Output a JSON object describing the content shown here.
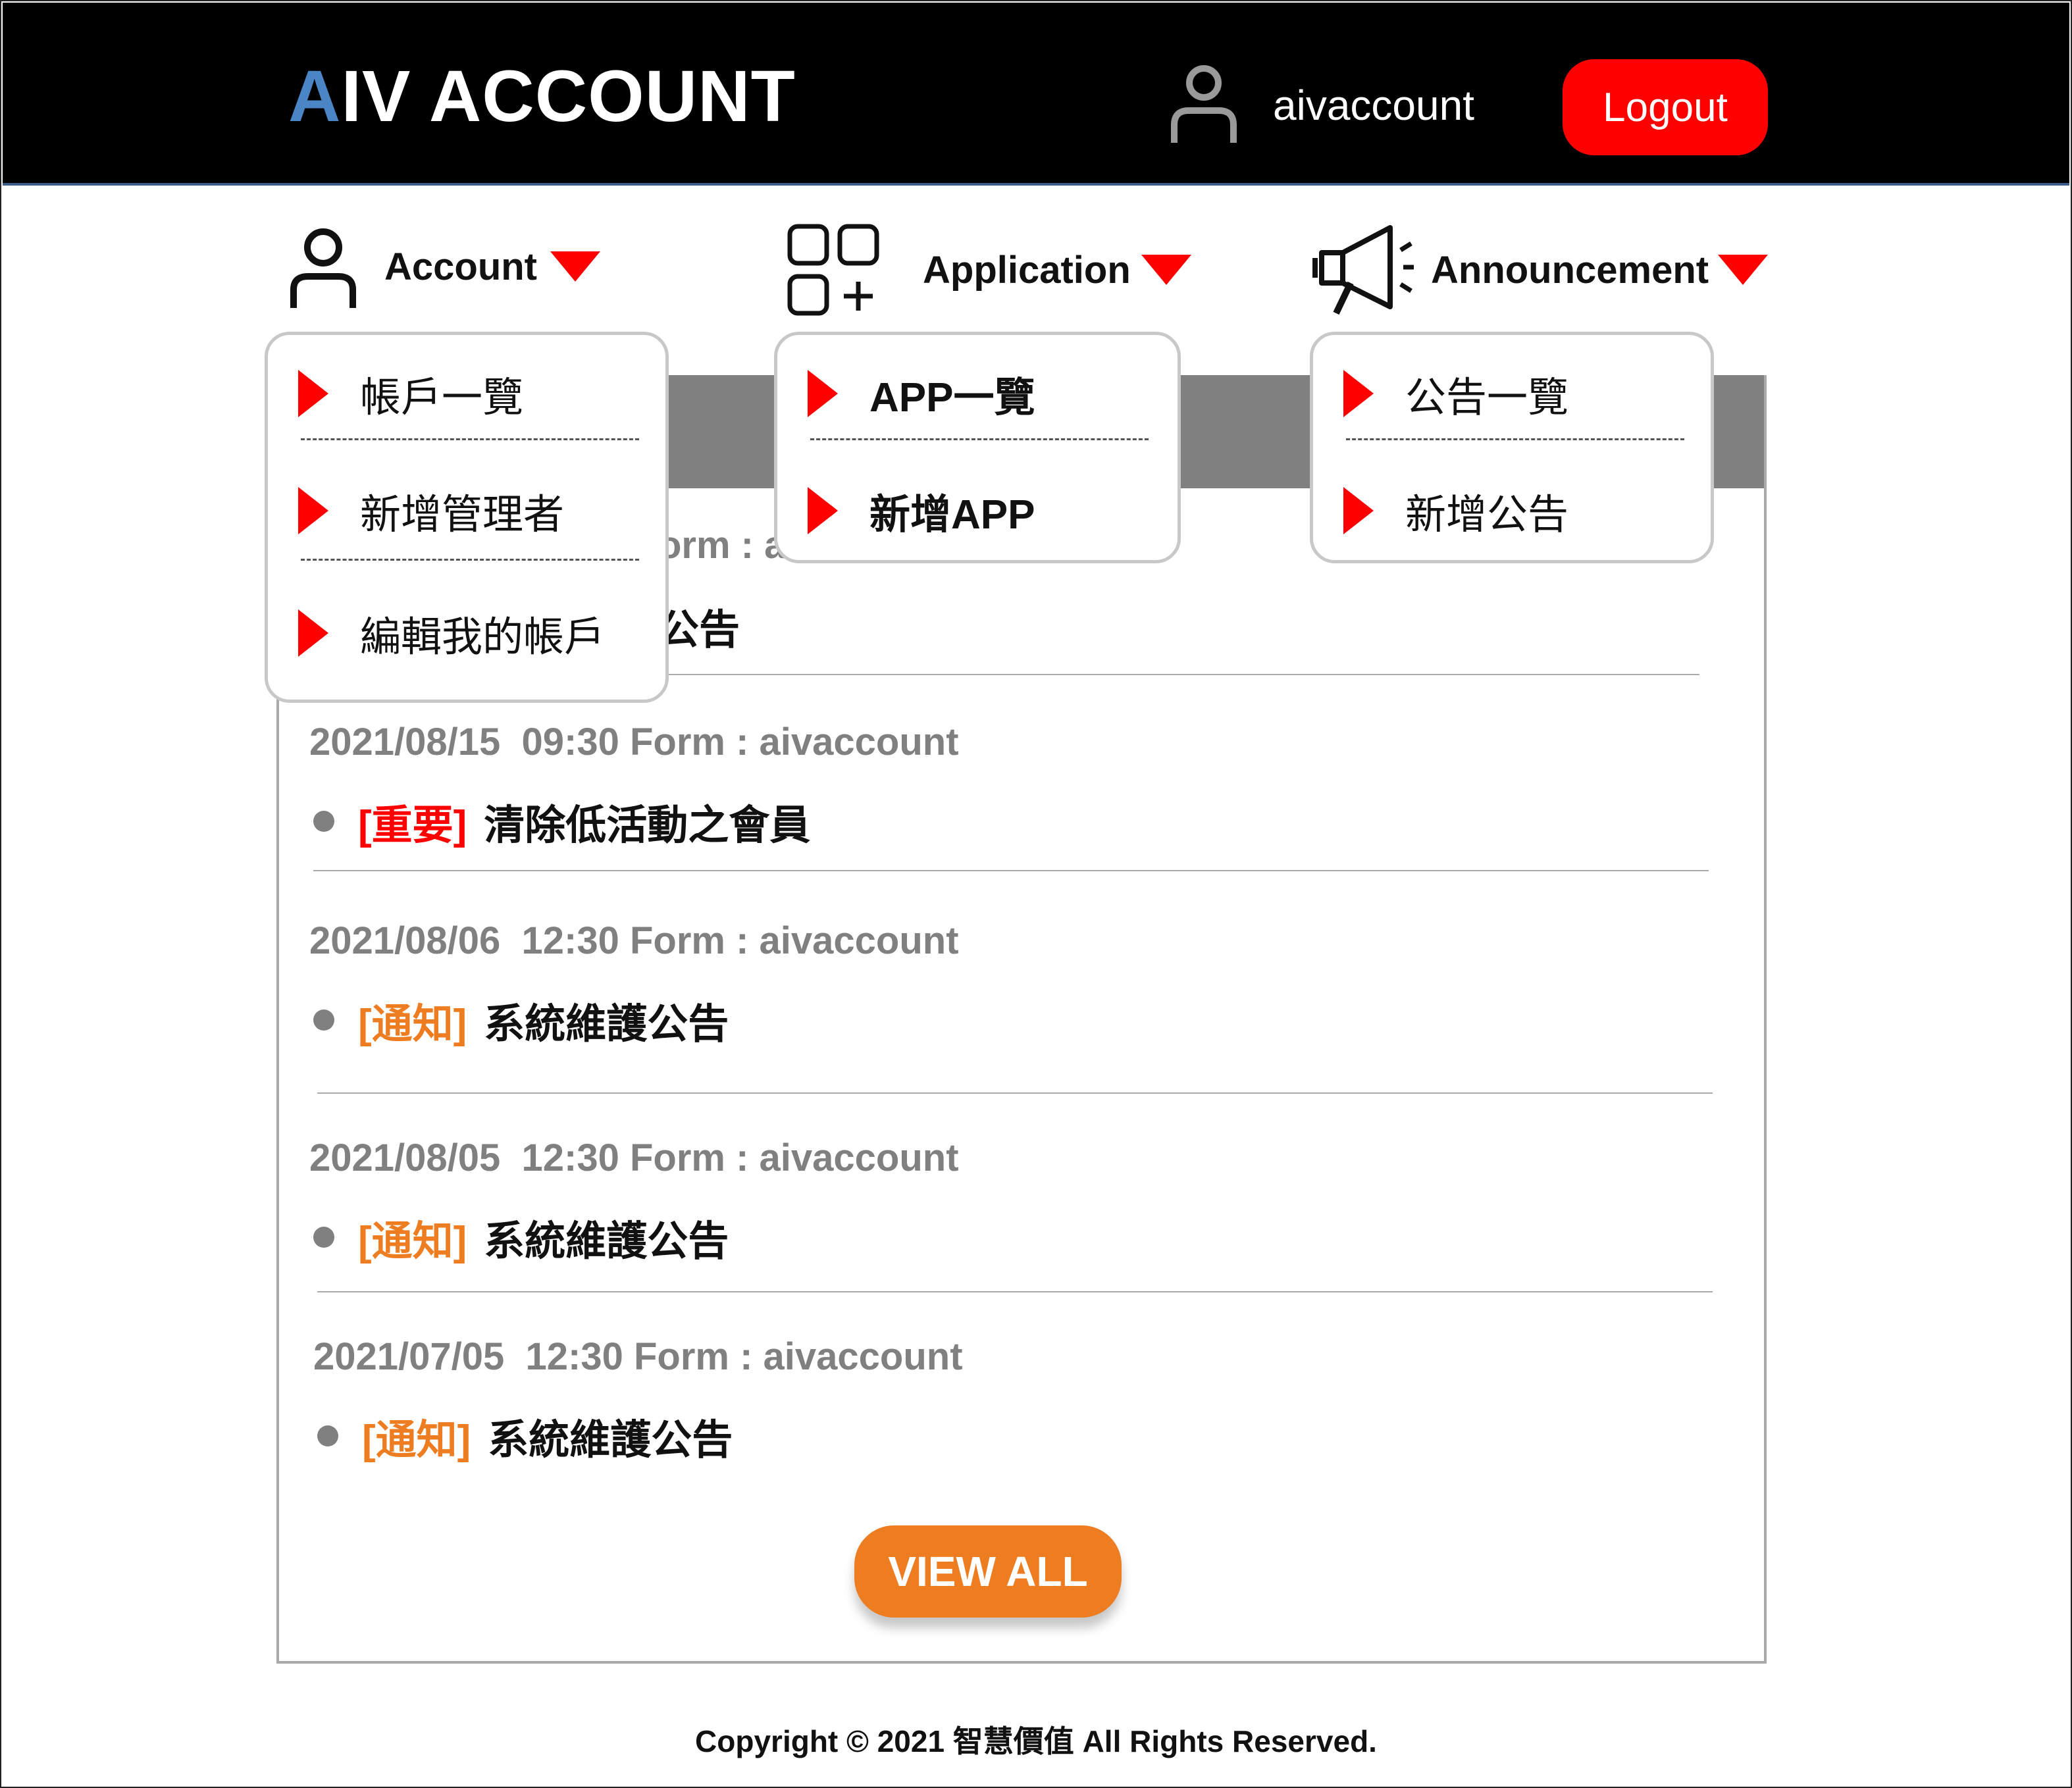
{
  "header": {
    "logo_first": "A",
    "logo_rest": "IV ACCOUNT",
    "username": "aivaccount",
    "logout_label": "Logout"
  },
  "nav": {
    "account": "Account",
    "application": "Application",
    "announcement": "Announcement"
  },
  "account_menu": [
    "帳戶一覽",
    "新增管理者",
    "編輯我的帳戶"
  ],
  "application_menu": [
    "APP一覽",
    "新增APP"
  ],
  "announcement_menu": [
    "公告一覽",
    "新增公告"
  ],
  "announcements": {
    "partial": {
      "meta": "orm : a",
      "title": "公告"
    },
    "items": [
      {
        "meta": "2021/08/15  09:30 Form : aivaccount",
        "tag": "[重要]",
        "title": "清除低活動之會員"
      },
      {
        "meta": "2021/08/06  12:30 Form : aivaccount",
        "tag": "[通知]",
        "title": "系統維護公告"
      },
      {
        "meta": "2021/08/05  12:30 Form : aivaccount",
        "tag": "[通知]",
        "title": "系統維護公告"
      },
      {
        "meta": "2021/07/05  12:30 Form : aivaccount",
        "tag": "[通知]",
        "title": "系統維護公告"
      }
    ]
  },
  "view_all_label": "VIEW ALL",
  "footer": "Copyright © 2021 智慧價值 All Rights Reserved.",
  "colors": {
    "accent_red": "#ff0000",
    "accent_orange": "#ee7d22",
    "logo_blue": "#4a86c5",
    "header_bg": "#000000"
  },
  "icons": {
    "user": "user-icon",
    "apps": "apps-grid-icon",
    "announcement": "megaphone-icon",
    "dropdown": "triangle-down-icon",
    "menu_item": "triangle-right-icon"
  }
}
